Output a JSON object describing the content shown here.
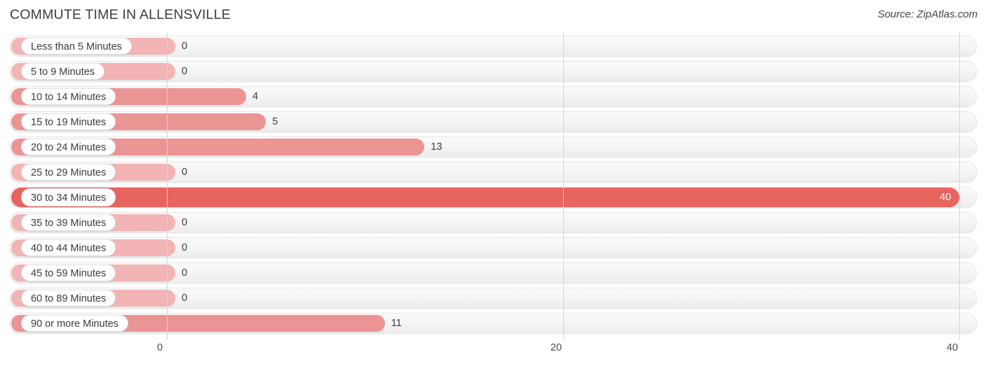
{
  "header": {
    "title": "COMMUTE TIME IN ALLENSVILLE",
    "source": "Source: ZipAtlas.com"
  },
  "colors": {
    "bar_zero": "#f2b4b4",
    "bar_normal": "#eb9494",
    "bar_max": "#e8645f",
    "track": "#f4f4f5",
    "gridline": "#d3d3d6",
    "text": "#3a3a40",
    "value_in_bar": "#ffffff"
  },
  "axis": {
    "ticks": [
      {
        "label": "0",
        "value": 0
      },
      {
        "label": "20",
        "value": 20
      },
      {
        "label": "40",
        "value": 40
      }
    ],
    "min": 0,
    "max": 40
  },
  "chart_data": {
    "type": "bar",
    "orientation": "horizontal",
    "title": "COMMUTE TIME IN ALLENSVILLE",
    "subtitle": "Source: ZipAtlas.com",
    "xlabel": "",
    "ylabel": "",
    "xlim": [
      0,
      40
    ],
    "grid": true,
    "legend": null,
    "categories": [
      "Less than 5 Minutes",
      "5 to 9 Minutes",
      "10 to 14 Minutes",
      "15 to 19 Minutes",
      "20 to 24 Minutes",
      "25 to 29 Minutes",
      "30 to 34 Minutes",
      "35 to 39 Minutes",
      "40 to 44 Minutes",
      "45 to 59 Minutes",
      "60 to 89 Minutes",
      "90 or more Minutes"
    ],
    "values": [
      0,
      0,
      4,
      5,
      13,
      0,
      40,
      0,
      0,
      0,
      0,
      11
    ],
    "value_labels": [
      "0",
      "0",
      "4",
      "5",
      "13",
      "0",
      "40",
      "0",
      "0",
      "0",
      "0",
      "11"
    ]
  },
  "rows": [
    {
      "label": "Less than 5 Minutes",
      "value": 0,
      "display": "0",
      "tone": "zero",
      "label_inside": false
    },
    {
      "label": "5 to 9 Minutes",
      "value": 0,
      "display": "0",
      "tone": "zero",
      "label_inside": false
    },
    {
      "label": "10 to 14 Minutes",
      "value": 4,
      "display": "4",
      "tone": "normal",
      "label_inside": false
    },
    {
      "label": "15 to 19 Minutes",
      "value": 5,
      "display": "5",
      "tone": "normal",
      "label_inside": false
    },
    {
      "label": "20 to 24 Minutes",
      "value": 13,
      "display": "13",
      "tone": "normal",
      "label_inside": false
    },
    {
      "label": "25 to 29 Minutes",
      "value": 0,
      "display": "0",
      "tone": "zero",
      "label_inside": false
    },
    {
      "label": "30 to 34 Minutes",
      "value": 40,
      "display": "40",
      "tone": "max",
      "label_inside": true
    },
    {
      "label": "35 to 39 Minutes",
      "value": 0,
      "display": "0",
      "tone": "zero",
      "label_inside": false
    },
    {
      "label": "40 to 44 Minutes",
      "value": 0,
      "display": "0",
      "tone": "zero",
      "label_inside": false
    },
    {
      "label": "45 to 59 Minutes",
      "value": 0,
      "display": "0",
      "tone": "zero",
      "label_inside": false
    },
    {
      "label": "60 to 89 Minutes",
      "value": 0,
      "display": "0",
      "tone": "zero",
      "label_inside": false
    },
    {
      "label": "90 or more Minutes",
      "value": 11,
      "display": "11",
      "tone": "normal",
      "label_inside": false
    }
  ]
}
